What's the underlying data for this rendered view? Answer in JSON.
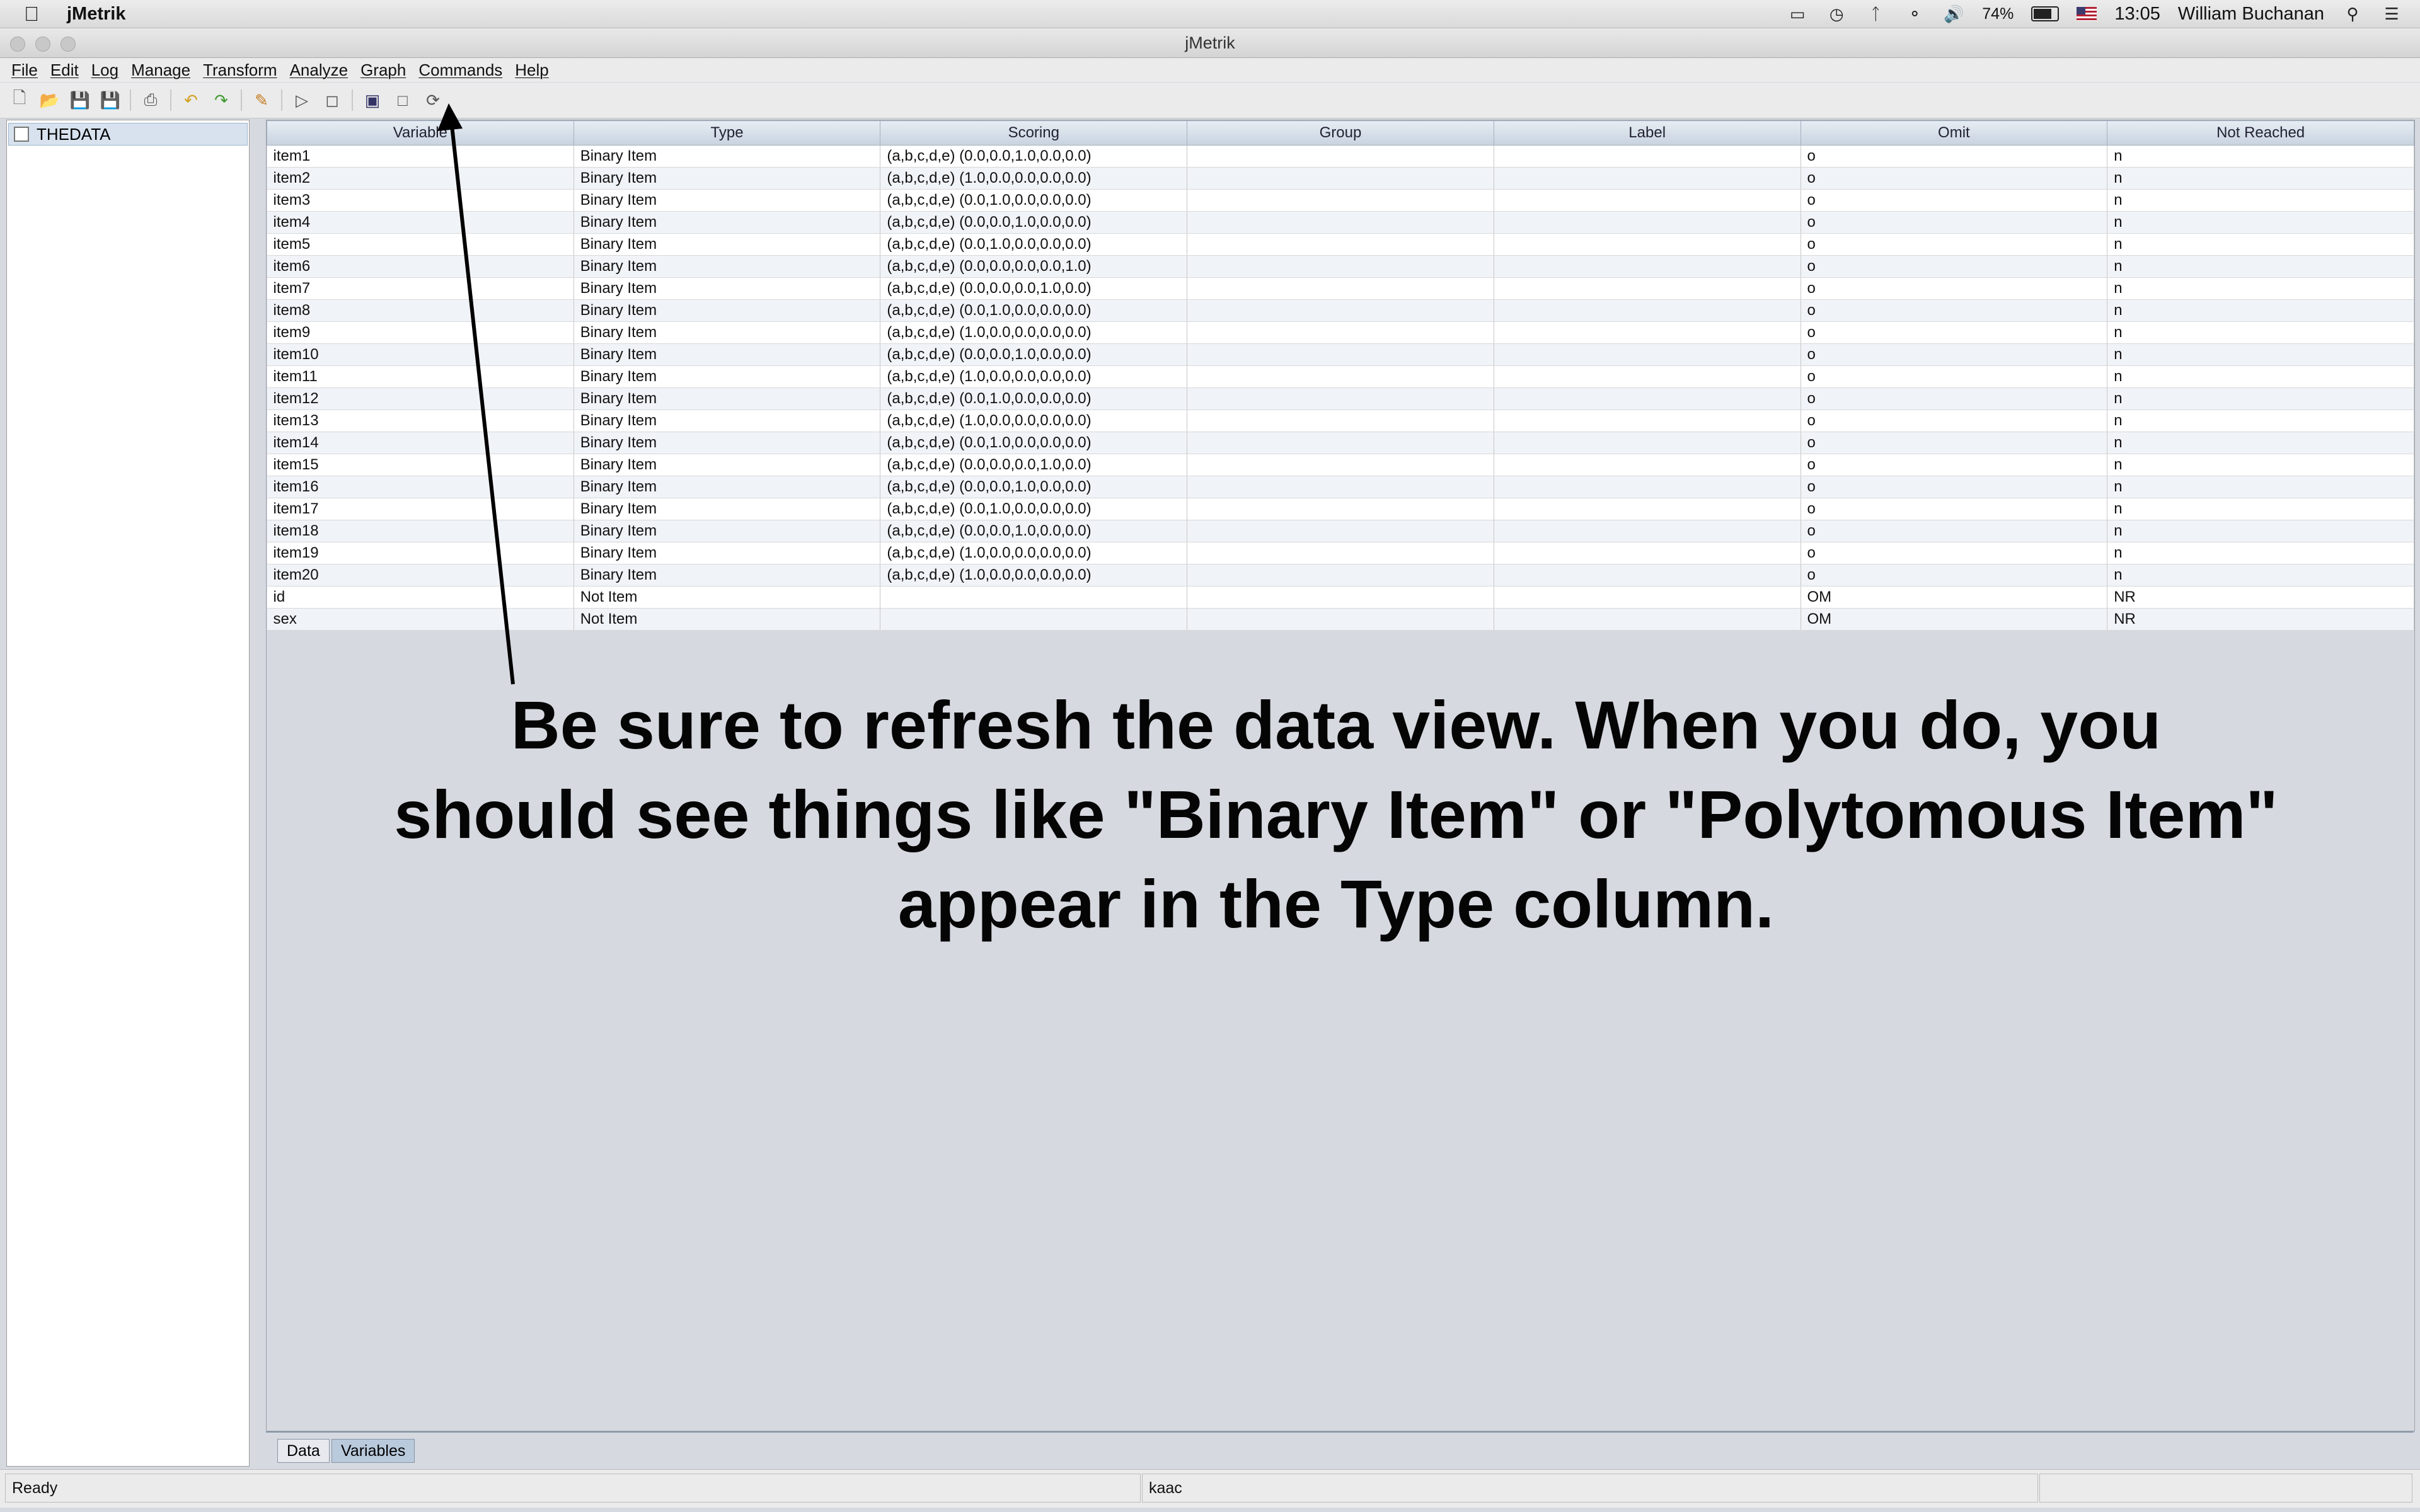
{
  "menubar": {
    "app_name": "jMetrik",
    "battery": "74%",
    "time": "13:05",
    "user": "William Buchanan"
  },
  "window": {
    "title": "jMetrik"
  },
  "app_menu": [
    "File",
    "Edit",
    "Log",
    "Manage",
    "Transform",
    "Analyze",
    "Graph",
    "Commands",
    "Help"
  ],
  "sidebar": {
    "items": [
      {
        "label": "THEDATA"
      }
    ]
  },
  "table": {
    "columns": [
      "Variable",
      "Type",
      "Scoring",
      "Group",
      "Label",
      "Omit",
      "Not Reached"
    ],
    "rows": [
      [
        "item1",
        "Binary Item",
        "(a,b,c,d,e) (0.0,0.0,1.0,0.0,0.0)",
        "",
        "",
        "o",
        "n"
      ],
      [
        "item2",
        "Binary Item",
        "(a,b,c,d,e) (1.0,0.0,0.0,0.0,0.0)",
        "",
        "",
        "o",
        "n"
      ],
      [
        "item3",
        "Binary Item",
        "(a,b,c,d,e) (0.0,1.0,0.0,0.0,0.0)",
        "",
        "",
        "o",
        "n"
      ],
      [
        "item4",
        "Binary Item",
        "(a,b,c,d,e) (0.0,0.0,1.0,0.0,0.0)",
        "",
        "",
        "o",
        "n"
      ],
      [
        "item5",
        "Binary Item",
        "(a,b,c,d,e) (0.0,1.0,0.0,0.0,0.0)",
        "",
        "",
        "o",
        "n"
      ],
      [
        "item6",
        "Binary Item",
        "(a,b,c,d,e) (0.0,0.0,0.0,0.0,1.0)",
        "",
        "",
        "o",
        "n"
      ],
      [
        "item7",
        "Binary Item",
        "(a,b,c,d,e) (0.0,0.0,0.0,1.0,0.0)",
        "",
        "",
        "o",
        "n"
      ],
      [
        "item8",
        "Binary Item",
        "(a,b,c,d,e) (0.0,1.0,0.0,0.0,0.0)",
        "",
        "",
        "o",
        "n"
      ],
      [
        "item9",
        "Binary Item",
        "(a,b,c,d,e) (1.0,0.0,0.0,0.0,0.0)",
        "",
        "",
        "o",
        "n"
      ],
      [
        "item10",
        "Binary Item",
        "(a,b,c,d,e) (0.0,0.0,1.0,0.0,0.0)",
        "",
        "",
        "o",
        "n"
      ],
      [
        "item11",
        "Binary Item",
        "(a,b,c,d,e) (1.0,0.0,0.0,0.0,0.0)",
        "",
        "",
        "o",
        "n"
      ],
      [
        "item12",
        "Binary Item",
        "(a,b,c,d,e) (0.0,1.0,0.0,0.0,0.0)",
        "",
        "",
        "o",
        "n"
      ],
      [
        "item13",
        "Binary Item",
        "(a,b,c,d,e) (1.0,0.0,0.0,0.0,0.0)",
        "",
        "",
        "o",
        "n"
      ],
      [
        "item14",
        "Binary Item",
        "(a,b,c,d,e) (0.0,1.0,0.0,0.0,0.0)",
        "",
        "",
        "o",
        "n"
      ],
      [
        "item15",
        "Binary Item",
        "(a,b,c,d,e) (0.0,0.0,0.0,1.0,0.0)",
        "",
        "",
        "o",
        "n"
      ],
      [
        "item16",
        "Binary Item",
        "(a,b,c,d,e) (0.0,0.0,1.0,0.0,0.0)",
        "",
        "",
        "o",
        "n"
      ],
      [
        "item17",
        "Binary Item",
        "(a,b,c,d,e) (0.0,1.0,0.0,0.0,0.0)",
        "",
        "",
        "o",
        "n"
      ],
      [
        "item18",
        "Binary Item",
        "(a,b,c,d,e) (0.0,0.0,1.0,0.0,0.0)",
        "",
        "",
        "o",
        "n"
      ],
      [
        "item19",
        "Binary Item",
        "(a,b,c,d,e) (1.0,0.0,0.0,0.0,0.0)",
        "",
        "",
        "o",
        "n"
      ],
      [
        "item20",
        "Binary Item",
        "(a,b,c,d,e) (1.0,0.0,0.0,0.0,0.0)",
        "",
        "",
        "o",
        "n"
      ],
      [
        "id",
        "Not Item",
        "",
        "",
        "",
        "OM",
        "NR"
      ],
      [
        "sex",
        "Not Item",
        "",
        "",
        "",
        "OM",
        "NR"
      ]
    ]
  },
  "tabs": [
    {
      "label": "Data"
    },
    {
      "label": "Variables"
    }
  ],
  "status": {
    "left": "Ready",
    "middle": "kaac",
    "right": ""
  },
  "annotation": {
    "line1": "Be sure to refresh the data view.  When you do, you",
    "line2": "should see things like \"Binary Item\" or \"Polytomous Item\"",
    "line3": "appear in the Type column."
  }
}
